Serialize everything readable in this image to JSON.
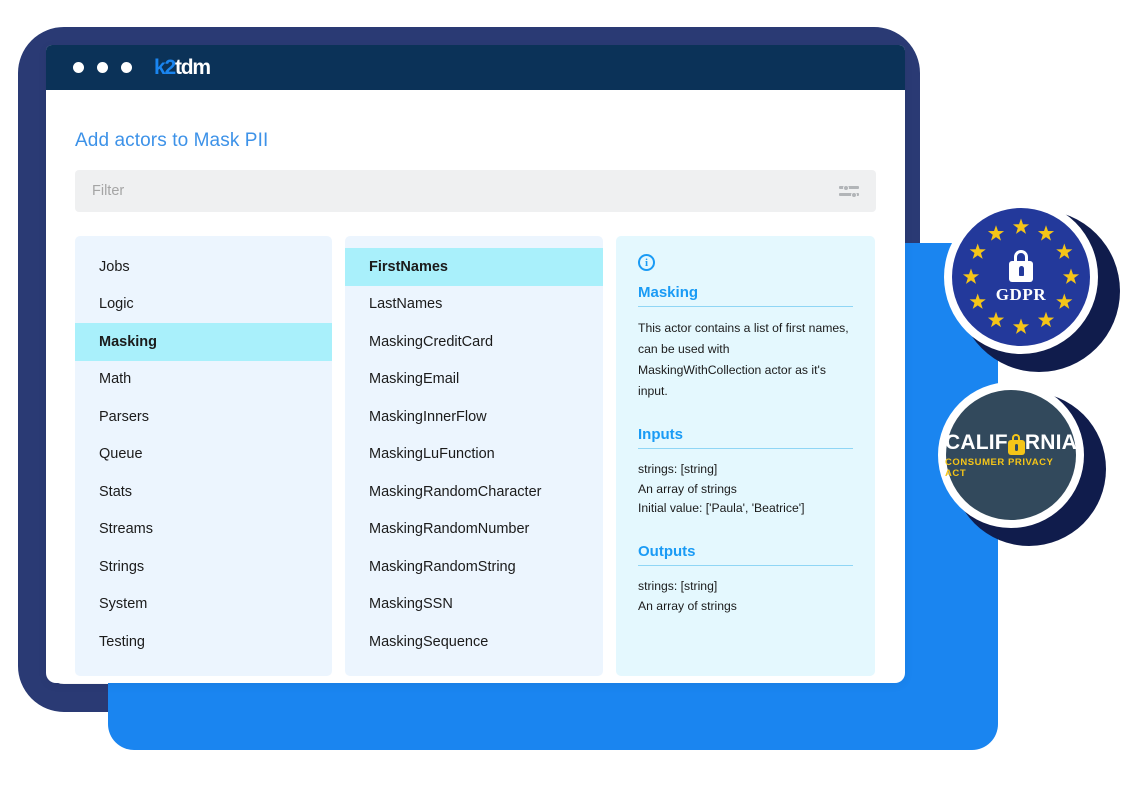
{
  "window": {
    "logo_primary": "k2",
    "logo_secondary": "tdm",
    "dots": [
      "dot",
      "dot",
      "dot"
    ]
  },
  "page": {
    "title": "Add actors to Mask PII"
  },
  "search": {
    "placeholder": "Filter",
    "value": "",
    "icon": "tune-icon"
  },
  "categories": {
    "selected": "Masking",
    "items": [
      {
        "label": "Jobs",
        "active": false
      },
      {
        "label": "Logic",
        "active": false
      },
      {
        "label": "Masking",
        "active": true
      },
      {
        "label": "Math",
        "active": false
      },
      {
        "label": "Parsers",
        "active": false
      },
      {
        "label": "Queue",
        "active": false
      },
      {
        "label": "Stats",
        "active": false
      },
      {
        "label": "Streams",
        "active": false
      },
      {
        "label": "Strings",
        "active": false
      },
      {
        "label": "System",
        "active": false
      },
      {
        "label": "Testing",
        "active": false
      }
    ]
  },
  "actors": {
    "selected": "FirstNames",
    "items": [
      {
        "label": "FirstNames",
        "active": true
      },
      {
        "label": "LastNames",
        "active": false
      },
      {
        "label": "MaskingCreditCard",
        "active": false
      },
      {
        "label": "MaskingEmail",
        "active": false
      },
      {
        "label": "MaskingInnerFlow",
        "active": false
      },
      {
        "label": "MaskingLuFunction",
        "active": false
      },
      {
        "label": "MaskingRandomCharacter",
        "active": false
      },
      {
        "label": "MaskingRandomNumber",
        "active": false
      },
      {
        "label": "MaskingRandomString",
        "active": false
      },
      {
        "label": "MaskingSSN",
        "active": false
      },
      {
        "label": "MaskingSequence",
        "active": false
      }
    ]
  },
  "details": {
    "info_icon": "info-icon",
    "heading": "Masking",
    "description": "This actor contains a list of first names, can be used with MaskingWithCollection actor as it's input.",
    "inputs_heading": "Inputs",
    "inputs": [
      "strings: [string]",
      "An array of strings",
      "Initial value: ['Paula', 'Beatrice']"
    ],
    "outputs_heading": "Outputs",
    "outputs": [
      "strings: [string]",
      "An array of strings"
    ]
  },
  "badges": {
    "gdpr": {
      "label": "GDPR",
      "icon": "lock-icon",
      "face_color": "#23399b",
      "star_color": "#f5c518",
      "star_count": 12
    },
    "ccpa": {
      "line1_before": "CALIF",
      "line1_after": "RNIA",
      "icon": "lock-icon",
      "line2": "CONSUMER PRIVACY ACT",
      "face_color": "#32495c",
      "accent_color": "#f5c518"
    }
  },
  "theme": {
    "accent_blue": "#1a85f0",
    "navy_frame": "#2a3a74",
    "titlebar": "#0b3258",
    "panel_blue": "#ecf5fe",
    "panel_cyan": "#e4f8fe",
    "selection": "#a9f0fb"
  }
}
